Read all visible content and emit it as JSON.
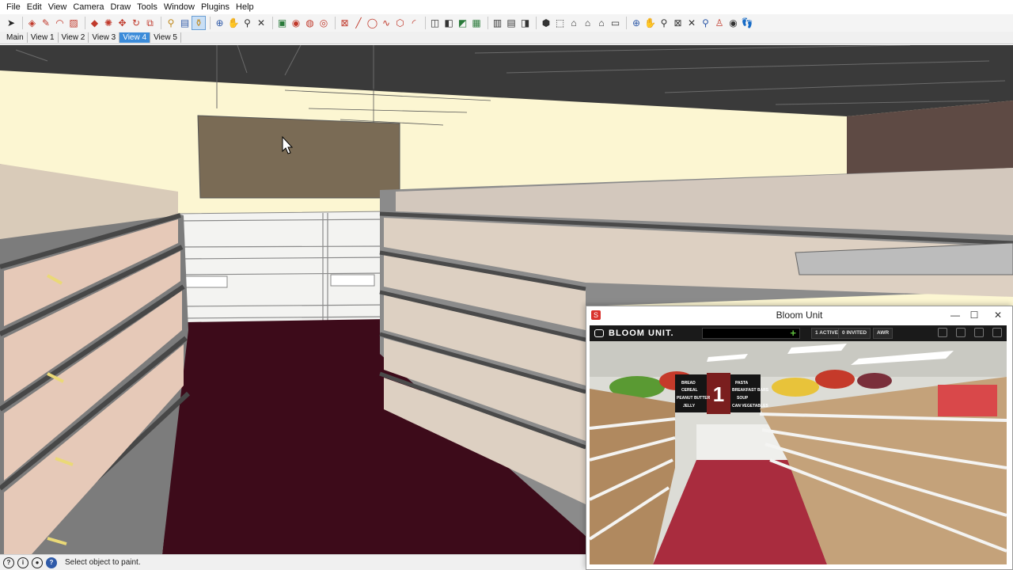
{
  "menu": [
    "File",
    "Edit",
    "View",
    "Camera",
    "Draw",
    "Tools",
    "Window",
    "Plugins",
    "Help"
  ],
  "scenes": [
    "Main",
    "View 1",
    "View 2",
    "View 3",
    "View 4",
    "View 5"
  ],
  "active_scene": "View 4",
  "status": {
    "text": "Select object to paint."
  },
  "bloom": {
    "title": "Bloom Unit",
    "logo": "BLOOM UNIT.",
    "active_count": "1",
    "active_label": "ACTIVE",
    "invited_count": "0",
    "invited_label": "INVITED",
    "awr_label": "AWR",
    "render_aisle_number": "1",
    "render_sign_left": [
      "BREAD",
      "CEREAL",
      "PEANUT BUTTER",
      "JELLY"
    ],
    "render_sign_right": [
      "PASTA",
      "BREAKFAST BARS",
      "SOUP",
      "CAN VEGETABLES"
    ]
  },
  "colors": {
    "floor": "#3d0b1a",
    "wall": "#fcf6d2",
    "ceiling": "#3a3a3a",
    "accent": "#3b8bd9"
  }
}
